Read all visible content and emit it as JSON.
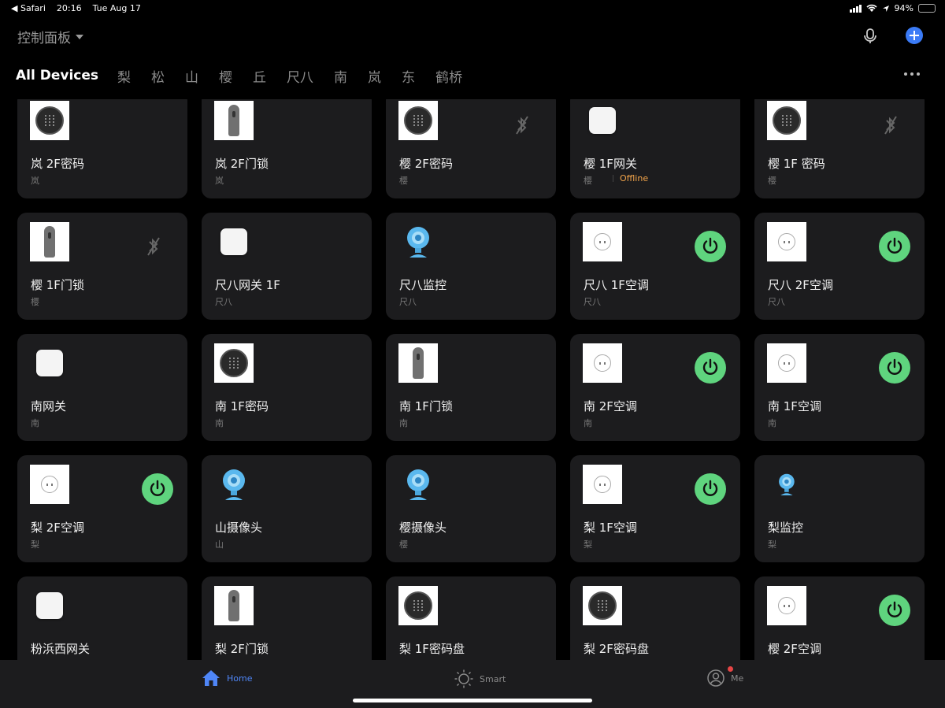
{
  "status": {
    "back_app": "◀ Safari",
    "time": "20:16",
    "date": "Tue Aug 17",
    "battery_pct": "94%",
    "battery_level": 0.94
  },
  "header": {
    "home_name": "控制面板"
  },
  "tabs": [
    "All Devices",
    "梨",
    "松",
    "山",
    "樱",
    "丘",
    "尺八",
    "南",
    "岚",
    "东",
    "鹤桥"
  ],
  "colors": {
    "accent": "#3b7bf6",
    "power_on": "#5fd47e",
    "offline": "#f3a54b",
    "card_bg": "#1c1c1e"
  },
  "devices": [
    {
      "name": "岚 2F密码",
      "room": "岚",
      "type": "keypad"
    },
    {
      "name": "岚 2F门锁",
      "room": "岚",
      "type": "lock"
    },
    {
      "name": "樱 2F密码",
      "room": "樱",
      "type": "keypad",
      "bt_off": true
    },
    {
      "name": "樱 1F网关",
      "room": "樱",
      "type": "gateway",
      "status": "Offline"
    },
    {
      "name": "樱 1F 密码",
      "room": "樱",
      "type": "keypad",
      "bt_off": true
    },
    {
      "name": "樱 1F门锁",
      "room": "樱",
      "type": "lock",
      "bt_off": true
    },
    {
      "name": "尺八网关 1F",
      "room": "尺八",
      "type": "gateway"
    },
    {
      "name": "尺八监控",
      "room": "尺八",
      "type": "camera"
    },
    {
      "name": "尺八 1F空调",
      "room": "尺八",
      "type": "outlet",
      "power": true
    },
    {
      "name": "尺八 2F空调",
      "room": "尺八",
      "type": "outlet",
      "power": true
    },
    {
      "name": "南网关",
      "room": "南",
      "type": "gateway"
    },
    {
      "name": "南 1F密码",
      "room": "南",
      "type": "keypad"
    },
    {
      "name": "南 1F门锁",
      "room": "南",
      "type": "lock"
    },
    {
      "name": "南 2F空调",
      "room": "南",
      "type": "outlet",
      "power": true
    },
    {
      "name": "南 1F空调",
      "room": "南",
      "type": "outlet",
      "power": true
    },
    {
      "name": "梨 2F空调",
      "room": "梨",
      "type": "outlet",
      "power": true
    },
    {
      "name": "山摄像头",
      "room": "山",
      "type": "camera"
    },
    {
      "name": "樱摄像头",
      "room": "樱",
      "type": "camera"
    },
    {
      "name": "梨 1F空调",
      "room": "梨",
      "type": "outlet",
      "power": true
    },
    {
      "name": "梨监控",
      "room": "梨",
      "type": "camera-small"
    },
    {
      "name": "粉浜西网关",
      "room": "",
      "type": "gateway"
    },
    {
      "name": "梨 2F门锁",
      "room": "",
      "type": "lock"
    },
    {
      "name": "梨 1F密码盘",
      "room": "",
      "type": "keypad"
    },
    {
      "name": "梨 2F密码盘",
      "room": "",
      "type": "keypad"
    },
    {
      "name": "樱 2F空调",
      "room": "",
      "type": "outlet",
      "power": true
    }
  ],
  "tabbar": {
    "home": "Home",
    "smart": "Smart",
    "me": "Me"
  }
}
